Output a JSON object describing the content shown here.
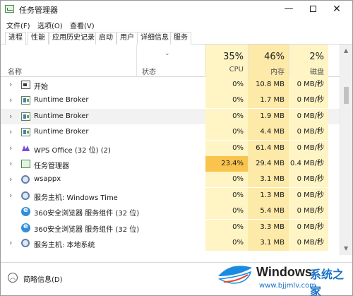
{
  "window": {
    "title": "任务管理器",
    "controls": {
      "minimize": "—",
      "close": "✕"
    }
  },
  "menu": [
    "文件(F)",
    "选项(O)",
    "查看(V)"
  ],
  "tabs": [
    "进程",
    "性能",
    "应用历史记录",
    "启动",
    "用户",
    "详细信息",
    "服务"
  ],
  "header": {
    "name": "名称",
    "status": "状态",
    "sort_indicator": "⌄",
    "cpu": {
      "percent": "35%",
      "label": "CPU"
    },
    "memory": {
      "percent": "46%",
      "label": "内存"
    },
    "disk": {
      "percent": "2%",
      "label": "磁盘"
    }
  },
  "processes": [
    {
      "name": "开始",
      "icon": "start-window-icon",
      "expandable": true,
      "cpu": "0%",
      "memory": "10.8 MB",
      "disk": "0 MB/秒",
      "highlight": false
    },
    {
      "name": "Runtime Broker",
      "icon": "runtime-broker-icon",
      "expandable": true,
      "cpu": "0%",
      "memory": "1.7 MB",
      "disk": "0 MB/秒",
      "highlight": false
    },
    {
      "name": "Runtime Broker",
      "icon": "runtime-broker-icon",
      "expandable": true,
      "cpu": "0%",
      "memory": "1.9 MB",
      "disk": "0 MB/秒",
      "highlight": true
    },
    {
      "name": "Runtime Broker",
      "icon": "runtime-broker-icon",
      "expandable": true,
      "cpu": "0%",
      "memory": "4.4 MB",
      "disk": "0 MB/秒",
      "highlight": false
    },
    {
      "name": "WPS Office (32 位) (2)",
      "icon": "wps-icon",
      "expandable": true,
      "cpu": "0%",
      "memory": "61.4 MB",
      "disk": "0 MB/秒",
      "highlight": false
    },
    {
      "name": "任务管理器",
      "icon": "task-manager-icon",
      "expandable": true,
      "cpu": "23.4%",
      "memory": "29.4 MB",
      "disk": "0.4 MB/秒",
      "highlight": false
    },
    {
      "name": "wsappx",
      "icon": "gear-icon",
      "expandable": true,
      "cpu": "0%",
      "memory": "3.1 MB",
      "disk": "0 MB/秒",
      "highlight": false
    },
    {
      "name": "服务主机: Windows Time",
      "icon": "gear-icon",
      "expandable": true,
      "cpu": "0%",
      "memory": "1.3 MB",
      "disk": "0 MB/秒",
      "highlight": false
    },
    {
      "name": "360安全浏览器 服务组件 (32 位)",
      "icon": "360-browser-icon",
      "expandable": false,
      "cpu": "0%",
      "memory": "5.4 MB",
      "disk": "0 MB/秒",
      "highlight": false
    },
    {
      "name": "360安全浏览器 服务组件 (32 位)",
      "icon": "360-browser-icon",
      "expandable": false,
      "cpu": "0%",
      "memory": "3.3 MB",
      "disk": "0 MB/秒",
      "highlight": false
    },
    {
      "name": "服务主机: 本地系统",
      "icon": "gear-icon",
      "expandable": true,
      "cpu": "0%",
      "memory": "3.1 MB",
      "disk": "0 MB/秒",
      "highlight": false
    }
  ],
  "footer": {
    "label": "简略信息(D)"
  },
  "colors": {
    "cpu_column": "#fff4c4",
    "memory_column": "#fde9a8",
    "disk_column": "#fff4c4",
    "cpu_hot": "#f9c34e",
    "memory_hot": "#fde9a8",
    "disk_hot": "#fde9a8",
    "row_highlight": "#f2f2f2"
  },
  "watermark": {
    "brand": "Windows",
    "site": "系统之家",
    "url": "www.bjjmlv.com"
  }
}
